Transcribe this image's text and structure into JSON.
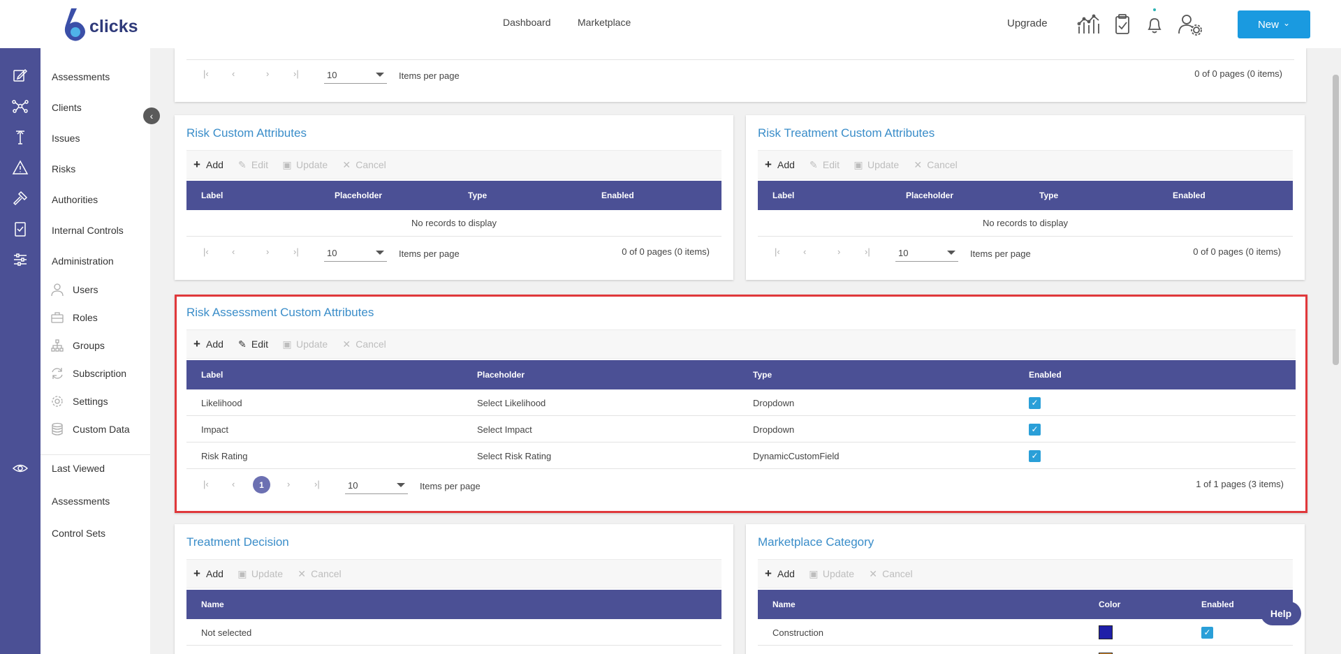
{
  "header": {
    "logo_digit": "6",
    "logo_text": "clicks",
    "nav": [
      "Dashboard",
      "Marketplace"
    ],
    "upgrade": "Upgrade",
    "icons": [
      "analytics-icon",
      "clipboard-check-icon",
      "bell-icon",
      "user-settings-icon"
    ],
    "new_button": "New",
    "new_caret": "⌄"
  },
  "sidebar": {
    "items": [
      {
        "label": "Assessments",
        "icon": "edit-icon"
      },
      {
        "label": "Clients",
        "icon": "network-icon"
      },
      {
        "label": "Issues",
        "icon": "issues-icon"
      },
      {
        "label": "Risks",
        "icon": "warning-icon"
      },
      {
        "label": "Authorities",
        "icon": "gavel-icon"
      },
      {
        "label": "Internal Controls",
        "icon": "checklist-icon"
      },
      {
        "label": "Administration",
        "icon": "sliders-icon"
      }
    ],
    "sub_items": [
      {
        "label": "Users",
        "icon": "user-icon"
      },
      {
        "label": "Roles",
        "icon": "briefcase-icon"
      },
      {
        "label": "Groups",
        "icon": "hierarchy-icon"
      },
      {
        "label": "Subscription",
        "icon": "refresh-icon"
      },
      {
        "label": "Settings",
        "icon": "gear-icon"
      },
      {
        "label": "Custom Data",
        "icon": "database-icon"
      }
    ],
    "last_viewed": {
      "label": "Last Viewed",
      "icon": "eye-icon"
    },
    "recent": [
      "Assessments",
      "Control Sets"
    ],
    "collapse": "‹"
  },
  "toolbar": {
    "add": "Add",
    "edit": "Edit",
    "update": "Update",
    "cancel": "Cancel"
  },
  "pager": {
    "page_size": "10",
    "items_per_page": "Items per page",
    "first": "|‹",
    "prev": "‹",
    "next": "›",
    "last": "›|"
  },
  "top_card": {
    "info": "0 of 0 pages (0 items)"
  },
  "risk_custom": {
    "title": "Risk Custom Attributes",
    "columns": [
      "Label",
      "Placeholder",
      "Type",
      "Enabled"
    ],
    "empty": "No records to display",
    "info": "0 of 0 pages (0 items)"
  },
  "risk_treatment": {
    "title": "Risk Treatment Custom Attributes",
    "columns": [
      "Label",
      "Placeholder",
      "Type",
      "Enabled"
    ],
    "empty": "No records to display",
    "info": "0 of 0 pages (0 items)"
  },
  "risk_assessment": {
    "title": "Risk Assessment Custom Attributes",
    "columns": [
      "Label",
      "Placeholder",
      "Type",
      "Enabled"
    ],
    "rows": [
      {
        "label": "Likelihood",
        "placeholder": "Select Likelihood",
        "type": "Dropdown",
        "enabled": true
      },
      {
        "label": "Impact",
        "placeholder": "Select Impact",
        "type": "Dropdown",
        "enabled": true
      },
      {
        "label": "Risk Rating",
        "placeholder": "Select Risk Rating",
        "type": "DynamicCustomField",
        "enabled": true
      }
    ],
    "current_page": "1",
    "info": "1 of 1 pages (3 items)"
  },
  "treatment_decision": {
    "title": "Treatment Decision",
    "columns": [
      "Name"
    ],
    "rows": [
      "Not selected"
    ]
  },
  "marketplace_category": {
    "title": "Marketplace Category",
    "columns": [
      "Name",
      "Color",
      "Enabled"
    ],
    "rows": [
      {
        "name": "Construction",
        "color": "#1f1fa8",
        "enabled": true
      }
    ],
    "next_row_color": "#e8922a"
  },
  "help": "Help",
  "checkmark": "✓"
}
